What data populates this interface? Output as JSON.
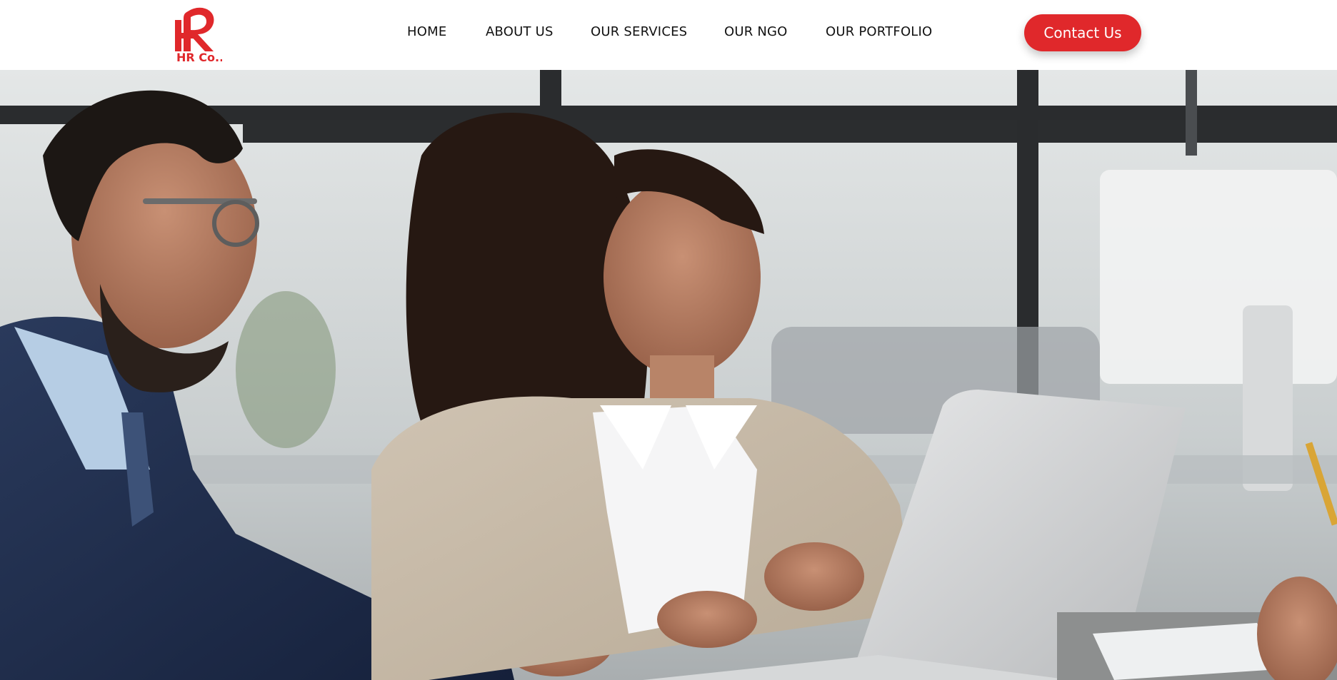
{
  "header": {
    "logo_text": "HR Co..",
    "brand_color": "#e0282b"
  },
  "nav": {
    "items": [
      {
        "label": "HOME"
      },
      {
        "label": "ABOUT US"
      },
      {
        "label": "OUR SERVICES"
      },
      {
        "label": "OUR NGO"
      },
      {
        "label": "OUR PORTFOLIO"
      }
    ]
  },
  "cta": {
    "label": "Contact Us"
  },
  "hero": {
    "image": "office-meeting-photo"
  }
}
